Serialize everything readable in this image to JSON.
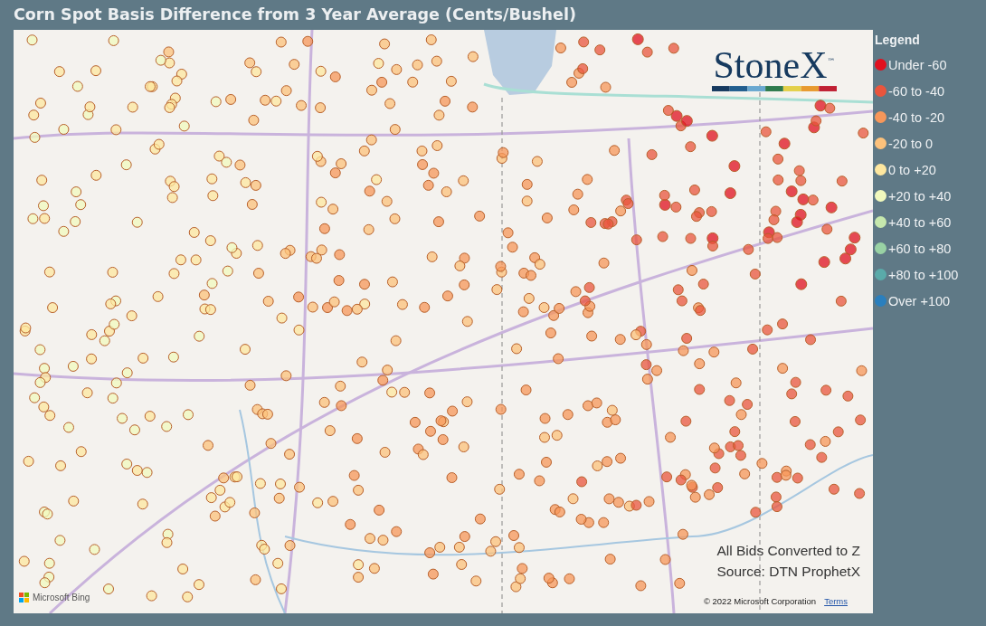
{
  "title": "Corn Spot Basis Difference from 3 Year Average (Cents/Bushel)",
  "map": {
    "logo": {
      "name": "StoneX",
      "mark": "™"
    },
    "notes": [
      "All Bids Converted to Z",
      "Source: DTN ProphetX"
    ],
    "attribution": {
      "brand": "Microsoft Bing",
      "copyright": "© 2022 Microsoft Corporation",
      "link": "Terms"
    }
  },
  "legend": {
    "title": "Legend",
    "items": [
      {
        "label": "Under -60",
        "color": "#e0101f"
      },
      {
        "label": "-60 to -40",
        "color": "#e9553d"
      },
      {
        "label": "-40 to -20",
        "color": "#f7975a"
      },
      {
        "label": "-20 to 0",
        "color": "#fcc17b"
      },
      {
        "label": "0 to +20",
        "color": "#fee79f"
      },
      {
        "label": "+20 to +40",
        "color": "#f1f9bd"
      },
      {
        "label": "+40 to +60",
        "color": "#c6e8ad"
      },
      {
        "label": "+60 to +80",
        "color": "#99d2a4"
      },
      {
        "label": "+80 to +100",
        "color": "#5aaaa9"
      },
      {
        "label": "Over +100",
        "color": "#2a7fbd"
      }
    ]
  }
}
